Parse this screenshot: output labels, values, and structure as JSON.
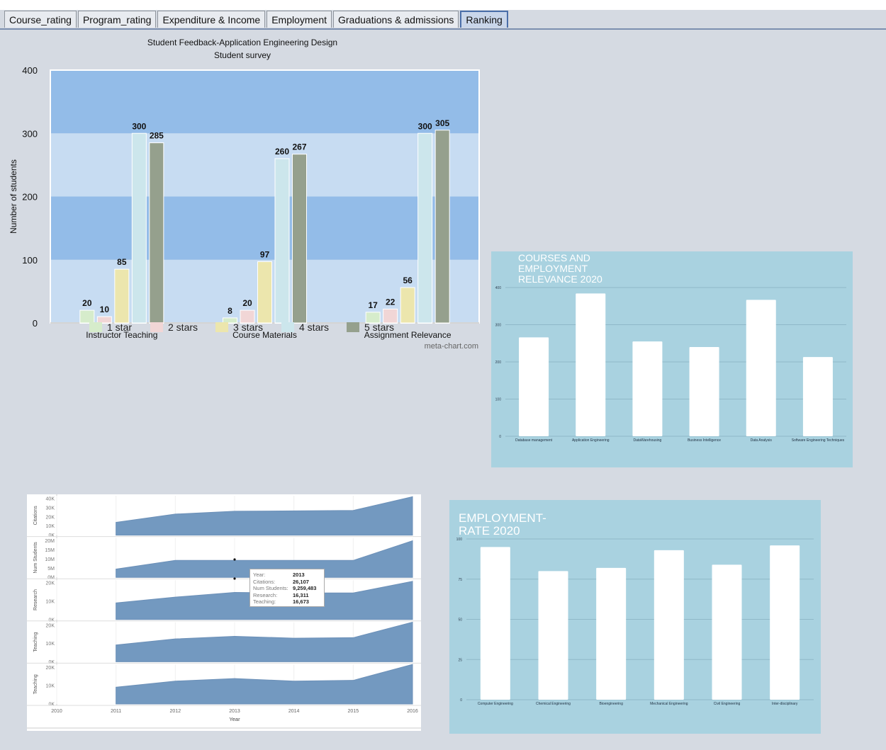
{
  "tabs": [
    {
      "label": "Course_rating",
      "active": false
    },
    {
      "label": "Program_rating",
      "active": false
    },
    {
      "label": "Expenditure & Income",
      "active": false
    },
    {
      "label": "Employment",
      "active": false
    },
    {
      "label": "Graduations & admissions",
      "active": false
    },
    {
      "label": "Ranking",
      "active": true
    }
  ],
  "feedback_chart": {
    "credit": "meta-chart.com"
  },
  "tooltip": {
    "rows": [
      {
        "key": "Year:",
        "value": "2013"
      },
      {
        "key": "Citations:",
        "value": "26,107"
      },
      {
        "key": "Num Students:",
        "value": "9,259,483"
      },
      {
        "key": "Research:",
        "value": "16,311"
      },
      {
        "key": "Teaching:",
        "value": "16,673"
      }
    ]
  },
  "chart_data": [
    {
      "type": "bar",
      "title": "Student Feedback-Application Engineering Design",
      "subtitle": "Student survey",
      "xlabel": "",
      "ylabel": "Number of students",
      "ylim": [
        0,
        400
      ],
      "yticks": [
        0,
        100,
        200,
        300,
        400
      ],
      "categories": [
        "Instructor Teaching",
        "Course Materials",
        "Assignment Relevance"
      ],
      "series": [
        {
          "name": "1 star",
          "values": [
            20,
            8,
            17
          ],
          "color": "#d6eccb"
        },
        {
          "name": "2 stars",
          "values": [
            10,
            20,
            22
          ],
          "color": "#f1d6d6"
        },
        {
          "name": "3 stars",
          "values": [
            85,
            97,
            56
          ],
          "color": "#ece6ad"
        },
        {
          "name": "4 stars",
          "values": [
            300,
            260,
            300
          ],
          "color": "#cce6ec"
        },
        {
          "name": "5 stars",
          "values": [
            285,
            267,
            305
          ],
          "color": "#95a08d"
        }
      ],
      "legend": "bottom",
      "grid": "alternating bands"
    },
    {
      "type": "bar",
      "title": "COURSES AND EMPLOYMENT RELEVANCE 2020",
      "ylim": [
        0,
        400
      ],
      "yticks": [
        0,
        100,
        200,
        300,
        400
      ],
      "categories": [
        "Database management",
        "Application Engineering",
        "DataWarehousing",
        "Business Intelligence",
        "Data Analysis",
        "Software Engineering Techniques"
      ],
      "values": [
        266,
        384,
        255,
        240,
        367,
        213
      ],
      "background": "#a9d2e0",
      "bar_color": "#ffffff"
    },
    {
      "type": "area",
      "xlabel": "Year",
      "x": [
        2011,
        2012,
        2013,
        2014,
        2015,
        2016
      ],
      "xticks": [
        2010,
        2011,
        2012,
        2013,
        2014,
        2015,
        2016
      ],
      "color": "#7399c0",
      "panels": [
        {
          "ylabel": "Citations",
          "yticks": [
            "0K",
            "10K",
            "20K",
            "30K",
            "40K"
          ],
          "ymax": 40000,
          "values": [
            14000,
            23000,
            26107,
            26500,
            27000,
            42000
          ]
        },
        {
          "ylabel": "Num Students",
          "yticks": [
            "0M",
            "5M",
            "10M",
            "15M",
            "20M"
          ],
          "ymax": 20000000,
          "values": [
            4500000,
            9259483,
            9259483,
            9259483,
            9259483,
            20000000
          ]
        },
        {
          "ylabel": "Research",
          "yticks": [
            "0K",
            "10K",
            "20K"
          ],
          "ymax": 22000,
          "values": [
            10000,
            13500,
            16311,
            16000,
            16000,
            23000
          ]
        },
        {
          "ylabel": "Teaching",
          "yticks": [
            "0K",
            "10K",
            "20K"
          ],
          "ymax": 24000,
          "values": [
            11000,
            15000,
            16673,
            15500,
            15800,
            26000
          ]
        },
        {
          "ylabel": "Teaching",
          "yticks": [
            "0K",
            "10K",
            "20K"
          ],
          "ymax": 24000,
          "values": [
            11000,
            15000,
            16673,
            15000,
            15500,
            26000
          ]
        }
      ]
    },
    {
      "type": "bar",
      "title": "EMPLOYMENT-RATE 2020",
      "ylim": [
        0,
        100
      ],
      "yticks": [
        0,
        25,
        50,
        75,
        100
      ],
      "categories": [
        "Computer Engineering",
        "Chemical Engineering",
        "Bioengineering",
        "Mechanical Engineering",
        "Civil Engineering",
        "Inter-disciplinary"
      ],
      "values": [
        95,
        80,
        82,
        93,
        84,
        96
      ],
      "background": "#a9d2e0",
      "bar_color": "#ffffff"
    }
  ]
}
